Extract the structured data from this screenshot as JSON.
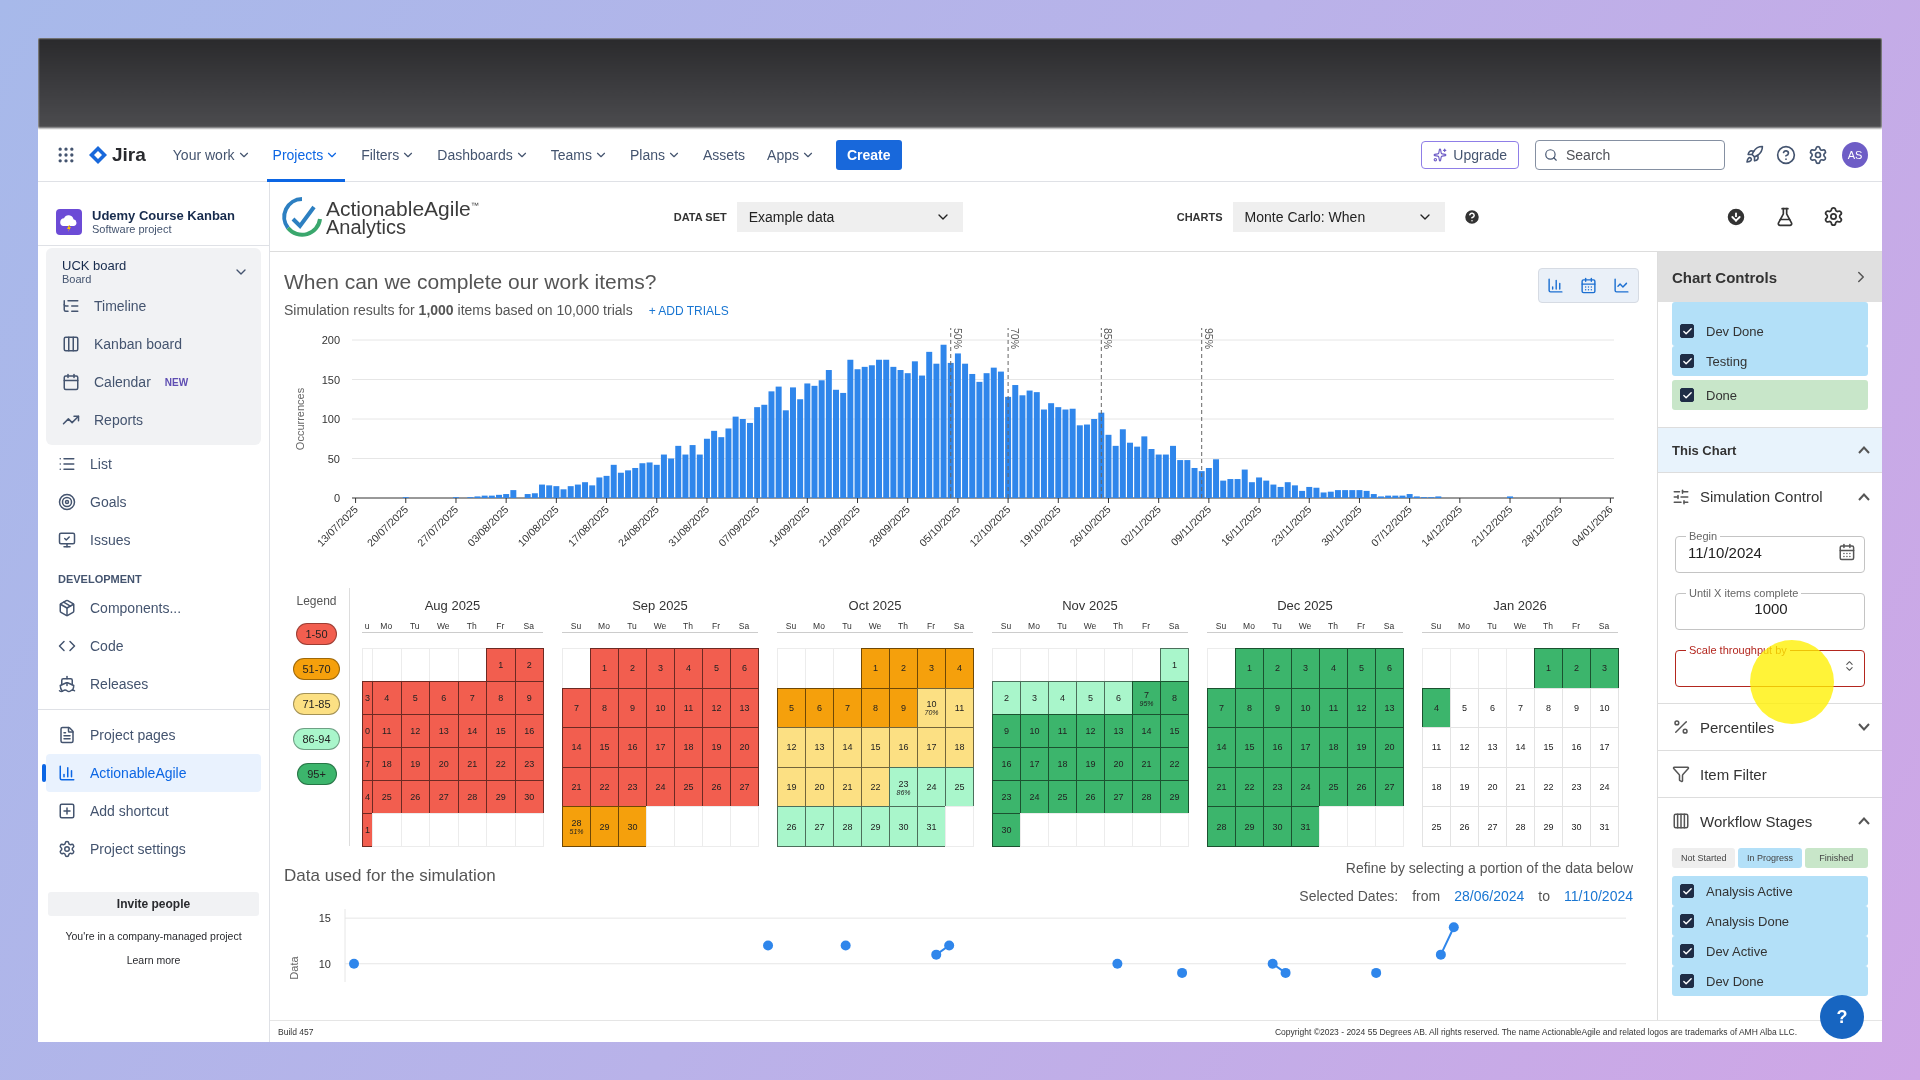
{
  "nav": {
    "product": "Jira",
    "items": [
      {
        "label": "Your work",
        "selected": false,
        "has_menu": true
      },
      {
        "label": "Projects",
        "selected": true,
        "has_menu": true
      },
      {
        "label": "Filters",
        "selected": false,
        "has_menu": true
      },
      {
        "label": "Dashboards",
        "selected": false,
        "has_menu": true
      },
      {
        "label": "Teams",
        "selected": false,
        "has_menu": true
      },
      {
        "label": "Plans",
        "selected": false,
        "has_menu": true
      },
      {
        "label": "Assets",
        "selected": false,
        "has_menu": false
      },
      {
        "label": "Apps",
        "selected": false,
        "has_menu": true
      }
    ],
    "create": "Create",
    "upgrade": "Upgrade",
    "search": {
      "placeholder": "Search"
    },
    "avatar": "AS"
  },
  "sidebar": {
    "project": {
      "name": "Udemy Course Kanban",
      "type": "Software project"
    },
    "board": {
      "name": "UCK board",
      "type": "Board",
      "items": [
        {
          "kind": "timeline",
          "label": "Timeline",
          "selected": false
        },
        {
          "kind": "kanban",
          "label": "Kanban board",
          "selected": false
        },
        {
          "kind": "calendar",
          "label": "Calendar",
          "badge": "NEW",
          "selected": false
        },
        {
          "kind": "reports",
          "label": "Reports",
          "selected": false
        }
      ]
    },
    "groups": [
      {
        "items": [
          {
            "kind": "list",
            "label": "List",
            "selected": false
          },
          {
            "kind": "goals",
            "label": "Goals",
            "selected": false
          },
          {
            "kind": "issues",
            "label": "Issues",
            "selected": false
          }
        ]
      },
      {
        "heading": "DEVELOPMENT",
        "items": [
          {
            "kind": "components",
            "label": "Components...",
            "selected": false
          },
          {
            "kind": "code",
            "label": "Code",
            "selected": false
          },
          {
            "kind": "releases",
            "label": "Releases",
            "selected": false
          }
        ]
      },
      {
        "items": [
          {
            "kind": "pages",
            "label": "Project pages",
            "selected": false
          },
          {
            "kind": "analytics",
            "label": "ActionableAgile",
            "selected": true
          },
          {
            "kind": "shortcut",
            "label": "Add shortcut",
            "selected": false
          },
          {
            "kind": "settings",
            "label": "Project settings",
            "selected": false
          }
        ]
      }
    ],
    "invite": "Invite people",
    "note": "You're in a company-managed project",
    "learn_more": "Learn more"
  },
  "toolbar": {
    "logo": {
      "name": "ActionableAgile",
      "mark": "™",
      "sub": "Analytics"
    },
    "dataset": {
      "label": "DATA SET",
      "value": "Example data"
    },
    "charts": {
      "label": "CHARTS",
      "value": "Monte Carlo: When"
    }
  },
  "chart_header": {
    "title": "When can we complete our work items?",
    "subtitle": "Simulation results for **1,000** items based on 10,000 trials",
    "link": "+ ADD TRIALS"
  },
  "histogram": {
    "chart_data": {
      "type": "bar",
      "ylabel": "Occurrences",
      "ylim": [
        0,
        200
      ],
      "yticks": [
        0,
        50,
        100,
        150,
        200
      ],
      "grid": true,
      "categories": [
        "13/07/2025",
        null,
        null,
        null,
        null,
        null,
        null,
        "20/07/2025",
        null,
        null,
        null,
        null,
        null,
        null,
        "27/07/2025",
        null,
        null,
        null,
        null,
        null,
        null,
        "03/08/2025",
        null,
        null,
        null,
        null,
        null,
        null,
        "10/08/2025",
        null,
        null,
        null,
        null,
        null,
        null,
        "17/08/2025",
        null,
        null,
        null,
        null,
        null,
        null,
        "24/08/2025",
        null,
        null,
        null,
        null,
        null,
        null,
        "31/08/2025",
        null,
        null,
        null,
        null,
        null,
        null,
        "07/09/2025",
        null,
        null,
        null,
        null,
        null,
        null,
        "14/09/2025",
        null,
        null,
        null,
        null,
        null,
        null,
        "21/09/2025",
        null,
        null,
        null,
        null,
        null,
        null,
        "28/09/2025",
        null,
        null,
        null,
        null,
        null,
        null,
        "05/10/2025",
        null,
        null,
        null,
        null,
        null,
        null,
        "12/10/2025",
        null,
        null,
        null,
        null,
        null,
        null,
        "19/10/2025",
        null,
        null,
        null,
        null,
        null,
        null,
        "26/10/2025",
        null,
        null,
        null,
        null,
        null,
        null,
        "02/11/2025",
        null,
        null,
        null,
        null,
        null,
        null,
        "09/11/2025",
        null,
        null,
        null,
        null,
        null,
        null,
        "16/11/2025",
        null,
        null,
        null,
        null,
        null,
        null,
        "23/11/2025",
        null,
        null,
        null,
        null,
        null,
        null,
        "30/11/2025",
        null,
        null,
        null,
        null,
        null,
        null,
        "07/12/2025",
        null,
        null,
        null,
        null,
        null,
        null,
        "14/12/2025",
        null,
        null,
        null,
        null,
        null,
        null,
        "21/12/2025",
        null,
        null,
        null,
        null,
        null,
        null,
        "28/12/2025",
        null,
        null,
        null,
        null,
        null,
        null,
        "04/01/2026"
      ],
      "values": [
        0,
        0,
        0,
        0,
        0,
        0,
        0,
        1,
        0,
        0,
        0,
        0,
        0,
        0,
        1,
        0,
        1,
        2,
        3,
        3,
        4,
        5,
        10,
        0,
        5,
        6,
        17,
        16,
        15,
        11,
        15,
        17,
        20,
        16,
        26,
        28,
        42,
        32,
        35,
        38,
        44,
        45,
        42,
        55,
        50,
        66,
        55,
        67,
        55,
        75,
        85,
        77,
        88,
        103,
        100,
        95,
        115,
        118,
        135,
        141,
        111,
        140,
        125,
        145,
        142,
        149,
        162,
        137,
        133,
        175,
        163,
        166,
        168,
        175,
        175,
        166,
        162,
        158,
        173,
        155,
        185,
        170,
        194,
        171,
        183,
        170,
        157,
        147,
        158,
        165,
        160,
        128,
        143,
        130,
        136,
        134,
        112,
        120,
        115,
        112,
        113,
        92,
        93,
        100,
        108,
        80,
        66,
        87,
        70,
        65,
        78,
        62,
        55,
        55,
        66,
        48,
        48,
        38,
        34,
        38,
        49,
        22,
        24,
        24,
        36,
        20,
        26,
        22,
        17,
        14,
        20,
        16,
        9,
        14,
        13,
        7,
        8,
        10,
        10,
        10,
        10,
        9,
        5,
        2,
        3,
        3,
        3,
        5,
        2,
        1,
        1,
        2,
        0,
        0,
        0,
        0,
        0,
        0,
        0,
        0,
        0,
        2,
        0,
        0,
        0,
        0,
        0,
        0,
        0,
        0,
        0,
        0,
        0,
        0,
        0,
        0
      ],
      "annotations": [
        "50%",
        "70%",
        "85%",
        "95%"
      ]
    }
  },
  "calendar": {
    "legend": {
      "title": "Legend",
      "items": [
        {
          "label": "1-50",
          "color": "#f25e4f"
        },
        {
          "label": "51-70",
          "color": "#f5a00c"
        },
        {
          "label": "71-85",
          "color": "#fce083"
        },
        {
          "label": "86-94",
          "color": "#a9f6cb"
        },
        {
          "label": "95+",
          "color": "#3cb56c"
        }
      ]
    },
    "months": [
      {
        "title": "Aug 2025",
        "first_column_cut": true,
        "weekdays": [
          "u",
          "Mo",
          "Tu",
          "We",
          "Th",
          "Fr",
          "Sa"
        ],
        "weeks": [
          [
            {
              "kind": "blank"
            },
            {
              "kind": "blank"
            },
            {
              "kind": "blank"
            },
            {
              "kind": "blank"
            },
            {
              "kind": "blank"
            },
            {
              "kind": "day",
              "d": "1",
              "color": "#f25e4f"
            },
            {
              "kind": "day",
              "d": "2",
              "color": "#f25e4f"
            }
          ],
          [
            {
              "kind": "day",
              "d": "3",
              "color": "#f25e4f"
            },
            {
              "kind": "day",
              "d": "4",
              "color": "#f25e4f"
            },
            {
              "kind": "day",
              "d": "5",
              "color": "#f25e4f"
            },
            {
              "kind": "day",
              "d": "6",
              "color": "#f25e4f"
            },
            {
              "kind": "day",
              "d": "7",
              "color": "#f25e4f"
            },
            {
              "kind": "day",
              "d": "8",
              "color": "#f25e4f"
            },
            {
              "kind": "day",
              "d": "9",
              "color": "#f25e4f"
            }
          ],
          [
            {
              "kind": "day",
              "d": "0",
              "color": "#f25e4f"
            },
            {
              "kind": "day",
              "d": "11",
              "color": "#f25e4f"
            },
            {
              "kind": "day",
              "d": "12",
              "color": "#f25e4f"
            },
            {
              "kind": "day",
              "d": "13",
              "color": "#f25e4f"
            },
            {
              "kind": "day",
              "d": "14",
              "color": "#f25e4f"
            },
            {
              "kind": "day",
              "d": "15",
              "color": "#f25e4f"
            },
            {
              "kind": "day",
              "d": "16",
              "color": "#f25e4f"
            }
          ],
          [
            {
              "kind": "day",
              "d": "7",
              "color": "#f25e4f"
            },
            {
              "kind": "day",
              "d": "18",
              "color": "#f25e4f"
            },
            {
              "kind": "day",
              "d": "19",
              "color": "#f25e4f"
            },
            {
              "kind": "day",
              "d": "20",
              "color": "#f25e4f"
            },
            {
              "kind": "day",
              "d": "21",
              "color": "#f25e4f"
            },
            {
              "kind": "day",
              "d": "22",
              "color": "#f25e4f"
            },
            {
              "kind": "day",
              "d": "23",
              "color": "#f25e4f"
            }
          ],
          [
            {
              "kind": "day",
              "d": "4",
              "color": "#f25e4f"
            },
            {
              "kind": "day",
              "d": "25",
              "color": "#f25e4f"
            },
            {
              "kind": "day",
              "d": "26",
              "color": "#f25e4f"
            },
            {
              "kind": "day",
              "d": "27",
              "color": "#f25e4f"
            },
            {
              "kind": "day",
              "d": "28",
              "color": "#f25e4f"
            },
            {
              "kind": "day",
              "d": "29",
              "color": "#f25e4f"
            },
            {
              "kind": "day",
              "d": "30",
              "color": "#f25e4f"
            }
          ],
          [
            {
              "kind": "day",
              "d": "1",
              "color": "#f25e4f"
            },
            {
              "kind": "blank"
            },
            {
              "kind": "blank"
            },
            {
              "kind": "blank"
            },
            {
              "kind": "blank"
            },
            {
              "kind": "blank"
            },
            {
              "kind": "blank"
            }
          ]
        ]
      },
      {
        "title": "Sep 2025",
        "first_column_cut": false,
        "weekdays": [
          "Su",
          "Mo",
          "Tu",
          "We",
          "Th",
          "Fr",
          "Sa"
        ],
        "weeks": [
          [
            {
              "kind": "blank"
            },
            {
              "kind": "day",
              "d": "1",
              "color": "#f25e4f"
            },
            {
              "kind": "day",
              "d": "2",
              "color": "#f25e4f"
            },
            {
              "kind": "day",
              "d": "3",
              "color": "#f25e4f"
            },
            {
              "kind": "day",
              "d": "4",
              "color": "#f25e4f"
            },
            {
              "kind": "day",
              "d": "5",
              "color": "#f25e4f"
            },
            {
              "kind": "day",
              "d": "6",
              "color": "#f25e4f"
            }
          ],
          [
            {
              "kind": "day",
              "d": "7",
              "color": "#f25e4f"
            },
            {
              "kind": "day",
              "d": "8",
              "color": "#f25e4f"
            },
            {
              "kind": "day",
              "d": "9",
              "color": "#f25e4f"
            },
            {
              "kind": "day",
              "d": "10",
              "color": "#f25e4f"
            },
            {
              "kind": "day",
              "d": "11",
              "color": "#f25e4f"
            },
            {
              "kind": "day",
              "d": "12",
              "color": "#f25e4f"
            },
            {
              "kind": "day",
              "d": "13",
              "color": "#f25e4f"
            }
          ],
          [
            {
              "kind": "day",
              "d": "14",
              "color": "#f25e4f"
            },
            {
              "kind": "day",
              "d": "15",
              "color": "#f25e4f"
            },
            {
              "kind": "day",
              "d": "16",
              "color": "#f25e4f"
            },
            {
              "kind": "day",
              "d": "17",
              "color": "#f25e4f"
            },
            {
              "kind": "day",
              "d": "18",
              "color": "#f25e4f"
            },
            {
              "kind": "day",
              "d": "19",
              "color": "#f25e4f"
            },
            {
              "kind": "day",
              "d": "20",
              "color": "#f25e4f"
            }
          ],
          [
            {
              "kind": "day",
              "d": "21",
              "color": "#f25e4f"
            },
            {
              "kind": "day",
              "d": "22",
              "color": "#f25e4f"
            },
            {
              "kind": "day",
              "d": "23",
              "color": "#f25e4f"
            },
            {
              "kind": "day",
              "d": "24",
              "color": "#f25e4f"
            },
            {
              "kind": "day",
              "d": "25",
              "color": "#f25e4f"
            },
            {
              "kind": "day",
              "d": "26",
              "color": "#f25e4f"
            },
            {
              "kind": "day",
              "d": "27",
              "color": "#f25e4f"
            }
          ],
          [
            {
              "kind": "day",
              "d": "28",
              "color": "#f5a00c",
              "note": "51%"
            },
            {
              "kind": "day",
              "d": "29",
              "color": "#f5a00c"
            },
            {
              "kind": "day",
              "d": "30",
              "color": "#f5a00c"
            },
            {
              "kind": "blank"
            },
            {
              "kind": "blank"
            },
            {
              "kind": "blank"
            },
            {
              "kind": "blank"
            }
          ]
        ]
      },
      {
        "title": "Oct 2025",
        "first_column_cut": false,
        "weekdays": [
          "Su",
          "Mo",
          "Tu",
          "We",
          "Th",
          "Fr",
          "Sa"
        ],
        "weeks": [
          [
            {
              "kind": "blank"
            },
            {
              "kind": "blank"
            },
            {
              "kind": "blank"
            },
            {
              "kind": "day",
              "d": "1",
              "color": "#f5a00c"
            },
            {
              "kind": "day",
              "d": "2",
              "color": "#f5a00c"
            },
            {
              "kind": "day",
              "d": "3",
              "color": "#f5a00c"
            },
            {
              "kind": "day",
              "d": "4",
              "color": "#f5a00c"
            }
          ],
          [
            {
              "kind": "day",
              "d": "5",
              "color": "#f5a00c"
            },
            {
              "kind": "day",
              "d": "6",
              "color": "#f5a00c"
            },
            {
              "kind": "day",
              "d": "7",
              "color": "#f5a00c"
            },
            {
              "kind": "day",
              "d": "8",
              "color": "#f5a00c"
            },
            {
              "kind": "day",
              "d": "9",
              "color": "#f5a00c"
            },
            {
              "kind": "day",
              "d": "10",
              "color": "#fce083",
              "note": "70%"
            },
            {
              "kind": "day",
              "d": "11",
              "color": "#fce083"
            }
          ],
          [
            {
              "kind": "day",
              "d": "12",
              "color": "#fce083"
            },
            {
              "kind": "day",
              "d": "13",
              "color": "#fce083"
            },
            {
              "kind": "day",
              "d": "14",
              "color": "#fce083"
            },
            {
              "kind": "day",
              "d": "15",
              "color": "#fce083"
            },
            {
              "kind": "day",
              "d": "16",
              "color": "#fce083"
            },
            {
              "kind": "day",
              "d": "17",
              "color": "#fce083"
            },
            {
              "kind": "day",
              "d": "18",
              "color": "#fce083"
            }
          ],
          [
            {
              "kind": "day",
              "d": "19",
              "color": "#fce083"
            },
            {
              "kind": "day",
              "d": "20",
              "color": "#fce083"
            },
            {
              "kind": "day",
              "d": "21",
              "color": "#fce083"
            },
            {
              "kind": "day",
              "d": "22",
              "color": "#fce083"
            },
            {
              "kind": "day",
              "d": "23",
              "color": "#a9f6cb",
              "note": "86%"
            },
            {
              "kind": "day",
              "d": "24",
              "color": "#a9f6cb"
            },
            {
              "kind": "day",
              "d": "25",
              "color": "#a9f6cb"
            }
          ],
          [
            {
              "kind": "day",
              "d": "26",
              "color": "#a9f6cb"
            },
            {
              "kind": "day",
              "d": "27",
              "color": "#a9f6cb"
            },
            {
              "kind": "day",
              "d": "28",
              "color": "#a9f6cb"
            },
            {
              "kind": "day",
              "d": "29",
              "color": "#a9f6cb"
            },
            {
              "kind": "day",
              "d": "30",
              "color": "#a9f6cb"
            },
            {
              "kind": "day",
              "d": "31",
              "color": "#a9f6cb"
            },
            {
              "kind": "blank"
            }
          ]
        ]
      },
      {
        "title": "Nov 2025",
        "first_column_cut": false,
        "weekdays": [
          "Su",
          "Mo",
          "Tu",
          "We",
          "Th",
          "Fr",
          "Sa"
        ],
        "weeks": [
          [
            {
              "kind": "blank"
            },
            {
              "kind": "blank"
            },
            {
              "kind": "blank"
            },
            {
              "kind": "blank"
            },
            {
              "kind": "blank"
            },
            {
              "kind": "blank"
            },
            {
              "kind": "day",
              "d": "1",
              "color": "#a9f6cb"
            }
          ],
          [
            {
              "kind": "day",
              "d": "2",
              "color": "#a9f6cb"
            },
            {
              "kind": "day",
              "d": "3",
              "color": "#a9f6cb"
            },
            {
              "kind": "day",
              "d": "4",
              "color": "#a9f6cb"
            },
            {
              "kind": "day",
              "d": "5",
              "color": "#a9f6cb"
            },
            {
              "kind": "day",
              "d": "6",
              "color": "#a9f6cb"
            },
            {
              "kind": "day",
              "d": "7",
              "color": "#3cb56c",
              "note": "95%"
            },
            {
              "kind": "day",
              "d": "8",
              "color": "#3cb56c"
            }
          ],
          [
            {
              "kind": "day",
              "d": "9",
              "color": "#3cb56c"
            },
            {
              "kind": "day",
              "d": "10",
              "color": "#3cb56c"
            },
            {
              "kind": "day",
              "d": "11",
              "color": "#3cb56c"
            },
            {
              "kind": "day",
              "d": "12",
              "color": "#3cb56c"
            },
            {
              "kind": "day",
              "d": "13",
              "color": "#3cb56c"
            },
            {
              "kind": "day",
              "d": "14",
              "color": "#3cb56c"
            },
            {
              "kind": "day",
              "d": "15",
              "color": "#3cb56c"
            }
          ],
          [
            {
              "kind": "day",
              "d": "16",
              "color": "#3cb56c"
            },
            {
              "kind": "day",
              "d": "17",
              "color": "#3cb56c"
            },
            {
              "kind": "day",
              "d": "18",
              "color": "#3cb56c"
            },
            {
              "kind": "day",
              "d": "19",
              "color": "#3cb56c"
            },
            {
              "kind": "day",
              "d": "20",
              "color": "#3cb56c"
            },
            {
              "kind": "day",
              "d": "21",
              "color": "#3cb56c"
            },
            {
              "kind": "day",
              "d": "22",
              "color": "#3cb56c"
            }
          ],
          [
            {
              "kind": "day",
              "d": "23",
              "color": "#3cb56c"
            },
            {
              "kind": "day",
              "d": "24",
              "color": "#3cb56c"
            },
            {
              "kind": "day",
              "d": "25",
              "color": "#3cb56c"
            },
            {
              "kind": "day",
              "d": "26",
              "color": "#3cb56c"
            },
            {
              "kind": "day",
              "d": "27",
              "color": "#3cb56c"
            },
            {
              "kind": "day",
              "d": "28",
              "color": "#3cb56c"
            },
            {
              "kind": "day",
              "d": "29",
              "color": "#3cb56c"
            }
          ],
          [
            {
              "kind": "day",
              "d": "30",
              "color": "#3cb56c"
            },
            {
              "kind": "blank"
            },
            {
              "kind": "blank"
            },
            {
              "kind": "blank"
            },
            {
              "kind": "blank"
            },
            {
              "kind": "blank"
            },
            {
              "kind": "blank"
            }
          ]
        ]
      },
      {
        "title": "Dec 2025",
        "first_column_cut": false,
        "weekdays": [
          "Su",
          "Mo",
          "Tu",
          "We",
          "Th",
          "Fr",
          "Sa"
        ],
        "weeks": [
          [
            {
              "kind": "blank"
            },
            {
              "kind": "day",
              "d": "1",
              "color": "#3cb56c"
            },
            {
              "kind": "day",
              "d": "2",
              "color": "#3cb56c"
            },
            {
              "kind": "day",
              "d": "3",
              "color": "#3cb56c"
            },
            {
              "kind": "day",
              "d": "4",
              "color": "#3cb56c"
            },
            {
              "kind": "day",
              "d": "5",
              "color": "#3cb56c"
            },
            {
              "kind": "day",
              "d": "6",
              "color": "#3cb56c"
            }
          ],
          [
            {
              "kind": "day",
              "d": "7",
              "color": "#3cb56c"
            },
            {
              "kind": "day",
              "d": "8",
              "color": "#3cb56c"
            },
            {
              "kind": "day",
              "d": "9",
              "color": "#3cb56c"
            },
            {
              "kind": "day",
              "d": "10",
              "color": "#3cb56c"
            },
            {
              "kind": "day",
              "d": "11",
              "color": "#3cb56c"
            },
            {
              "kind": "day",
              "d": "12",
              "color": "#3cb56c"
            },
            {
              "kind": "day",
              "d": "13",
              "color": "#3cb56c"
            }
          ],
          [
            {
              "kind": "day",
              "d": "14",
              "color": "#3cb56c"
            },
            {
              "kind": "day",
              "d": "15",
              "color": "#3cb56c"
            },
            {
              "kind": "day",
              "d": "16",
              "color": "#3cb56c"
            },
            {
              "kind": "day",
              "d": "17",
              "color": "#3cb56c"
            },
            {
              "kind": "day",
              "d": "18",
              "color": "#3cb56c"
            },
            {
              "kind": "day",
              "d": "19",
              "color": "#3cb56c"
            },
            {
              "kind": "day",
              "d": "20",
              "color": "#3cb56c"
            }
          ],
          [
            {
              "kind": "day",
              "d": "21",
              "color": "#3cb56c"
            },
            {
              "kind": "day",
              "d": "22",
              "color": "#3cb56c"
            },
            {
              "kind": "day",
              "d": "23",
              "color": "#3cb56c"
            },
            {
              "kind": "day",
              "d": "24",
              "color": "#3cb56c"
            },
            {
              "kind": "day",
              "d": "25",
              "color": "#3cb56c"
            },
            {
              "kind": "day",
              "d": "26",
              "color": "#3cb56c"
            },
            {
              "kind": "day",
              "d": "27",
              "color": "#3cb56c"
            }
          ],
          [
            {
              "kind": "day",
              "d": "28",
              "color": "#3cb56c"
            },
            {
              "kind": "day",
              "d": "29",
              "color": "#3cb56c"
            },
            {
              "kind": "day",
              "d": "30",
              "color": "#3cb56c"
            },
            {
              "kind": "day",
              "d": "31",
              "color": "#3cb56c"
            },
            {
              "kind": "blank"
            },
            {
              "kind": "blank"
            },
            {
              "kind": "blank"
            }
          ]
        ]
      },
      {
        "title": "Jan 2026",
        "first_column_cut": false,
        "weekdays": [
          "Su",
          "Mo",
          "Tu",
          "We",
          "Th",
          "Fr",
          "Sa"
        ],
        "weeks": [
          [
            {
              "kind": "blank"
            },
            {
              "kind": "blank"
            },
            {
              "kind": "blank"
            },
            {
              "kind": "blank"
            },
            {
              "kind": "day",
              "d": "1",
              "color": "#3cb56c"
            },
            {
              "kind": "day",
              "d": "2",
              "color": "#3cb56c"
            },
            {
              "kind": "day",
              "d": "3",
              "color": "#3cb56c"
            }
          ],
          [
            {
              "kind": "day",
              "d": "4",
              "color": "#3cb56c"
            },
            {
              "kind": "day",
              "d": "5"
            },
            {
              "kind": "day",
              "d": "6"
            },
            {
              "kind": "day",
              "d": "7"
            },
            {
              "kind": "day",
              "d": "8"
            },
            {
              "kind": "day",
              "d": "9"
            },
            {
              "kind": "day",
              "d": "10"
            }
          ],
          [
            {
              "kind": "day",
              "d": "11"
            },
            {
              "kind": "day",
              "d": "12"
            },
            {
              "kind": "day",
              "d": "13"
            },
            {
              "kind": "day",
              "d": "14"
            },
            {
              "kind": "day",
              "d": "15"
            },
            {
              "kind": "day",
              "d": "16"
            },
            {
              "kind": "day",
              "d": "17"
            }
          ],
          [
            {
              "kind": "day",
              "d": "18"
            },
            {
              "kind": "day",
              "d": "19"
            },
            {
              "kind": "day",
              "d": "20"
            },
            {
              "kind": "day",
              "d": "21"
            },
            {
              "kind": "day",
              "d": "22"
            },
            {
              "kind": "day",
              "d": "23"
            },
            {
              "kind": "day",
              "d": "24"
            }
          ],
          [
            {
              "kind": "day",
              "d": "25"
            },
            {
              "kind": "day",
              "d": "26"
            },
            {
              "kind": "day",
              "d": "27"
            },
            {
              "kind": "day",
              "d": "28"
            },
            {
              "kind": "day",
              "d": "29"
            },
            {
              "kind": "day",
              "d": "30"
            },
            {
              "kind": "day",
              "d": "31"
            }
          ]
        ]
      }
    ]
  },
  "data_section": {
    "title": "Data used for the simulation",
    "hint": "Refine by selecting a portion of the data below",
    "selected_label": "Selected Dates:",
    "from_label": "from",
    "from": "28/06/2024",
    "to_label": "to",
    "to": "11/10/2024",
    "chart_data": {
      "type": "line",
      "ylabel": "Data",
      "ylim": [
        8,
        16
      ],
      "yticks": [
        10,
        15
      ],
      "grid": true,
      "series": [
        {
          "color": "#2f86eb",
          "marker": true,
          "values": [
            10,
            null,
            null,
            null,
            null,
            null,
            null,
            null,
            null,
            null,
            null,
            null,
            null,
            null,
            null,
            null,
            null,
            null,
            null,
            null,
            null,
            null,
            null,
            null,
            null,
            null,
            null,
            null,
            null,
            null,
            null,
            null,
            12,
            null,
            null,
            null,
            null,
            null,
            12,
            null,
            null,
            null,
            null,
            null,
            null,
            11,
            12,
            null,
            null,
            null,
            null,
            null,
            null,
            null,
            null,
            null,
            null,
            null,
            null,
            10,
            null,
            null,
            null,
            null,
            9,
            null,
            null,
            null,
            null,
            null,
            null,
            10,
            9,
            null,
            null,
            null,
            null,
            null,
            null,
            9,
            null,
            null,
            null,
            null,
            11,
            14,
            null,
            null,
            null,
            null,
            null,
            null,
            null,
            null,
            null,
            null,
            null,
            null,
            null
          ]
        }
      ]
    }
  },
  "footer": {
    "build": "Build 457",
    "copyright": "Copyright ©2023 - 2024 55 Degrees AB. All rights reserved. The name ActionableAgile and related logos are trademarks of AMH Alba LLC."
  },
  "panel": {
    "title": "Chart Controls",
    "stages_top": [
      {
        "label": "Dev Done",
        "checked": true,
        "kind": "in_progress"
      },
      {
        "label": "Testing",
        "checked": true,
        "kind": "in_progress"
      },
      {
        "label": "Done",
        "checked": true,
        "kind": "finished"
      }
    ],
    "this_chart": {
      "title": "This Chart",
      "expanded": true
    },
    "simulation": {
      "title": "Simulation Control",
      "expanded": true,
      "fields": [
        {
          "label": "Begin",
          "value": "11/10/2024",
          "kind": "date",
          "error": false
        },
        {
          "label": "Until X items complete",
          "value": "1000",
          "kind": "text",
          "error": false
        },
        {
          "label": "Scale throughput by",
          "kind": "number",
          "error": true
        }
      ]
    },
    "percentiles": {
      "title": "Percentiles",
      "expanded": false
    },
    "item_filter": {
      "title": "Item Filter"
    },
    "workflow": {
      "title": "Workflow Stages",
      "expanded": true,
      "chips": [
        {
          "label": "Not Started",
          "kind": "not_started"
        },
        {
          "label": "In Progress",
          "kind": "in_progress"
        },
        {
          "label": "Finished",
          "kind": "finished"
        }
      ],
      "stages": [
        {
          "label": "Analysis Active",
          "checked": true,
          "kind": "in_progress"
        },
        {
          "label": "Analysis Done",
          "checked": true,
          "kind": "in_progress"
        },
        {
          "label": "Dev Active",
          "checked": true,
          "kind": "in_progress"
        },
        {
          "label": "Dev Done",
          "checked": true,
          "kind": "in_progress"
        }
      ]
    }
  },
  "help_button": "?"
}
